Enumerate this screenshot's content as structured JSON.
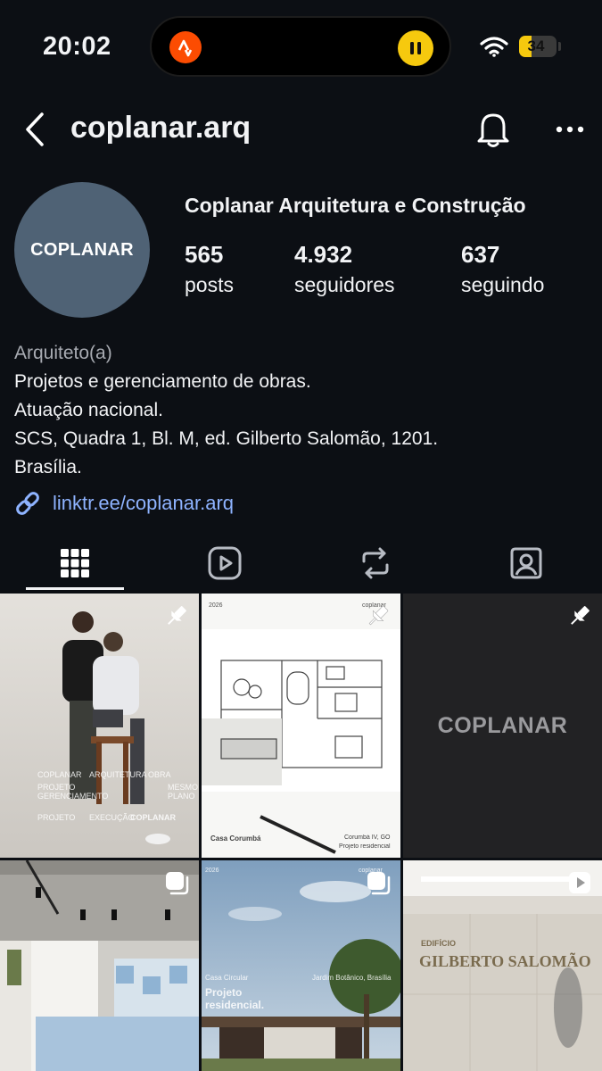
{
  "status_bar": {
    "time": "20:02",
    "battery": "34"
  },
  "header": {
    "username": "coplanar.arq",
    "icons": [
      "back-arrow-icon",
      "bell-icon",
      "more-icon"
    ]
  },
  "profile": {
    "avatar_text": "COPLANAR",
    "display_name": "Coplanar Arquitetura e Construção",
    "stats": [
      {
        "value": "565",
        "label": "posts"
      },
      {
        "value": "4.932",
        "label": "seguidores"
      },
      {
        "value": "637",
        "label": "seguindo"
      }
    ]
  },
  "bio": {
    "category": "Arquiteto(a)",
    "lines": [
      "Projetos e gerenciamento de obras.",
      "Atuação nacional.",
      "SCS, Quadra 1, Bl. M, ed. Gilberto Salomão, 1201.",
      "Brasília."
    ],
    "link": "linktr.ee/coplanar.arq"
  },
  "tabs": [
    "grid-icon",
    "reels-icon",
    "reposts-icon",
    "tagged-icon"
  ],
  "posts": [
    {
      "badge": "pin-icon",
      "labels": [
        "COPLANAR",
        "ARQUITETURA",
        "OBRA",
        "PROJETO",
        "GERENCIAMENTO",
        "MESMO PLANO",
        "PROJETO",
        "EXECUÇÃO",
        "COPLANAR"
      ]
    },
    {
      "badge": "pin-icon",
      "labels": [
        "2026",
        "coplanar",
        "Casa Corumbá",
        "Corumbá IV, GO",
        "Projeto residencial"
      ]
    },
    {
      "badge": "pin-icon",
      "labels": [
        "COPLANAR"
      ]
    },
    {
      "badge": "carousel-icon",
      "labels": []
    },
    {
      "badge": "carousel-icon",
      "labels": [
        "2026",
        "coplanar",
        "Casa Circular",
        "Jardim Botânico, Brasília",
        "Projeto",
        "residencial."
      ]
    },
    {
      "badge": "reel-icon",
      "labels": [
        "EDIFÍCIO",
        "GILBERTO SALOMÃO"
      ]
    }
  ],
  "colors": {
    "background": "#0c0f14",
    "link": "#8eb3ff",
    "avatar": "#4f6275"
  }
}
